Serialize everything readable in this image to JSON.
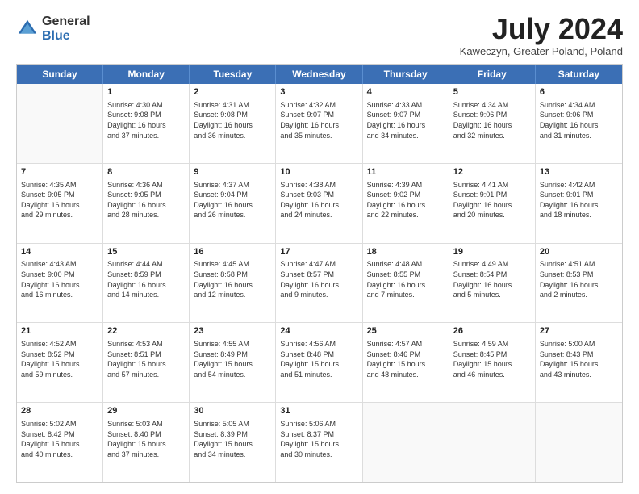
{
  "logo": {
    "general": "General",
    "blue": "Blue"
  },
  "title": {
    "month_year": "July 2024",
    "location": "Kaweczyn, Greater Poland, Poland"
  },
  "header_days": [
    "Sunday",
    "Monday",
    "Tuesday",
    "Wednesday",
    "Thursday",
    "Friday",
    "Saturday"
  ],
  "weeks": [
    [
      {
        "day": "",
        "info": "",
        "empty": true
      },
      {
        "day": "1",
        "info": "Sunrise: 4:30 AM\nSunset: 9:08 PM\nDaylight: 16 hours\nand 37 minutes."
      },
      {
        "day": "2",
        "info": "Sunrise: 4:31 AM\nSunset: 9:08 PM\nDaylight: 16 hours\nand 36 minutes."
      },
      {
        "day": "3",
        "info": "Sunrise: 4:32 AM\nSunset: 9:07 PM\nDaylight: 16 hours\nand 35 minutes."
      },
      {
        "day": "4",
        "info": "Sunrise: 4:33 AM\nSunset: 9:07 PM\nDaylight: 16 hours\nand 34 minutes."
      },
      {
        "day": "5",
        "info": "Sunrise: 4:34 AM\nSunset: 9:06 PM\nDaylight: 16 hours\nand 32 minutes."
      },
      {
        "day": "6",
        "info": "Sunrise: 4:34 AM\nSunset: 9:06 PM\nDaylight: 16 hours\nand 31 minutes."
      }
    ],
    [
      {
        "day": "7",
        "info": "Sunrise: 4:35 AM\nSunset: 9:05 PM\nDaylight: 16 hours\nand 29 minutes."
      },
      {
        "day": "8",
        "info": "Sunrise: 4:36 AM\nSunset: 9:05 PM\nDaylight: 16 hours\nand 28 minutes."
      },
      {
        "day": "9",
        "info": "Sunrise: 4:37 AM\nSunset: 9:04 PM\nDaylight: 16 hours\nand 26 minutes."
      },
      {
        "day": "10",
        "info": "Sunrise: 4:38 AM\nSunset: 9:03 PM\nDaylight: 16 hours\nand 24 minutes."
      },
      {
        "day": "11",
        "info": "Sunrise: 4:39 AM\nSunset: 9:02 PM\nDaylight: 16 hours\nand 22 minutes."
      },
      {
        "day": "12",
        "info": "Sunrise: 4:41 AM\nSunset: 9:01 PM\nDaylight: 16 hours\nand 20 minutes."
      },
      {
        "day": "13",
        "info": "Sunrise: 4:42 AM\nSunset: 9:01 PM\nDaylight: 16 hours\nand 18 minutes."
      }
    ],
    [
      {
        "day": "14",
        "info": "Sunrise: 4:43 AM\nSunset: 9:00 PM\nDaylight: 16 hours\nand 16 minutes."
      },
      {
        "day": "15",
        "info": "Sunrise: 4:44 AM\nSunset: 8:59 PM\nDaylight: 16 hours\nand 14 minutes."
      },
      {
        "day": "16",
        "info": "Sunrise: 4:45 AM\nSunset: 8:58 PM\nDaylight: 16 hours\nand 12 minutes."
      },
      {
        "day": "17",
        "info": "Sunrise: 4:47 AM\nSunset: 8:57 PM\nDaylight: 16 hours\nand 9 minutes."
      },
      {
        "day": "18",
        "info": "Sunrise: 4:48 AM\nSunset: 8:55 PM\nDaylight: 16 hours\nand 7 minutes."
      },
      {
        "day": "19",
        "info": "Sunrise: 4:49 AM\nSunset: 8:54 PM\nDaylight: 16 hours\nand 5 minutes."
      },
      {
        "day": "20",
        "info": "Sunrise: 4:51 AM\nSunset: 8:53 PM\nDaylight: 16 hours\nand 2 minutes."
      }
    ],
    [
      {
        "day": "21",
        "info": "Sunrise: 4:52 AM\nSunset: 8:52 PM\nDaylight: 15 hours\nand 59 minutes."
      },
      {
        "day": "22",
        "info": "Sunrise: 4:53 AM\nSunset: 8:51 PM\nDaylight: 15 hours\nand 57 minutes."
      },
      {
        "day": "23",
        "info": "Sunrise: 4:55 AM\nSunset: 8:49 PM\nDaylight: 15 hours\nand 54 minutes."
      },
      {
        "day": "24",
        "info": "Sunrise: 4:56 AM\nSunset: 8:48 PM\nDaylight: 15 hours\nand 51 minutes."
      },
      {
        "day": "25",
        "info": "Sunrise: 4:57 AM\nSunset: 8:46 PM\nDaylight: 15 hours\nand 48 minutes."
      },
      {
        "day": "26",
        "info": "Sunrise: 4:59 AM\nSunset: 8:45 PM\nDaylight: 15 hours\nand 46 minutes."
      },
      {
        "day": "27",
        "info": "Sunrise: 5:00 AM\nSunset: 8:43 PM\nDaylight: 15 hours\nand 43 minutes."
      }
    ],
    [
      {
        "day": "28",
        "info": "Sunrise: 5:02 AM\nSunset: 8:42 PM\nDaylight: 15 hours\nand 40 minutes."
      },
      {
        "day": "29",
        "info": "Sunrise: 5:03 AM\nSunset: 8:40 PM\nDaylight: 15 hours\nand 37 minutes."
      },
      {
        "day": "30",
        "info": "Sunrise: 5:05 AM\nSunset: 8:39 PM\nDaylight: 15 hours\nand 34 minutes."
      },
      {
        "day": "31",
        "info": "Sunrise: 5:06 AM\nSunset: 8:37 PM\nDaylight: 15 hours\nand 30 minutes."
      },
      {
        "day": "",
        "info": "",
        "empty": true
      },
      {
        "day": "",
        "info": "",
        "empty": true
      },
      {
        "day": "",
        "info": "",
        "empty": true
      }
    ]
  ]
}
